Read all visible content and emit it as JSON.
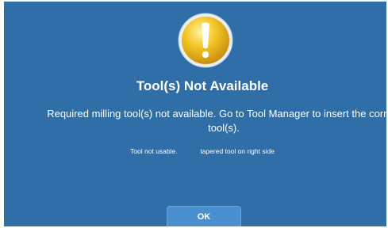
{
  "dialog": {
    "icon": "warning-exclamation-icon",
    "title": "Tool(s) Not Available",
    "message_line1": "Required milling tool(s) not available.  Go to Tool Manager to insert the correct",
    "message_line2": "tool(s).",
    "detail_status": "Tool not usable.",
    "detail_reason": "tapered tool on right side",
    "ok_label": "OK"
  },
  "colors": {
    "background": "#2f6ea6",
    "button": "#4a90d0",
    "icon_gold": "#e6b21a"
  }
}
